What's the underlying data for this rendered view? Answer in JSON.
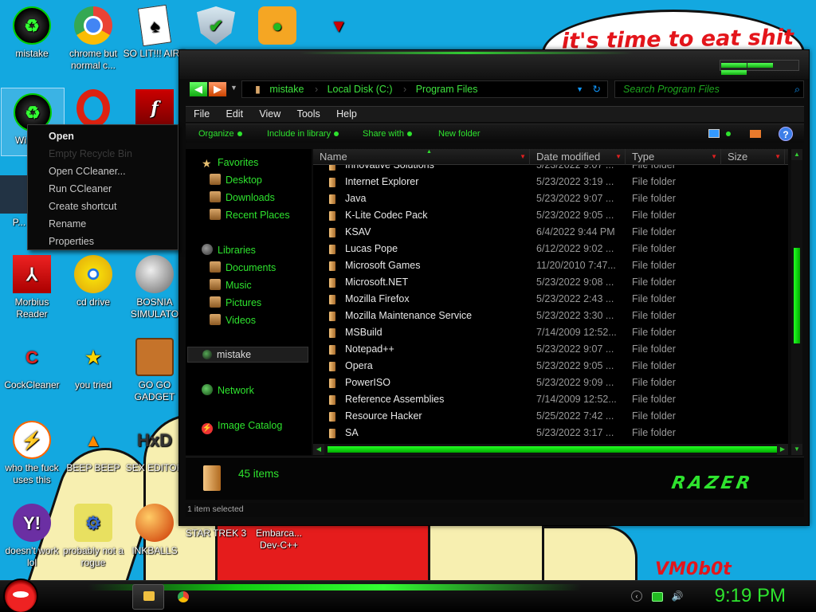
{
  "wallpaper": {
    "bubble_text": "it's time to eat shit",
    "signature": "VM0b0t"
  },
  "desktop_icons": [
    {
      "label": "mistake",
      "icon": "razer-recycle-icon"
    },
    {
      "label": "chrome but normal c...",
      "icon": "chrome-icon"
    },
    {
      "label": "SO LIT!!! AIRE",
      "icon": "playing-cards-icon"
    },
    {
      "label": "",
      "icon": "shield-icon"
    },
    {
      "label": "",
      "icon": "bad-piggies-icon"
    },
    {
      "label": "",
      "icon": "eagle-logo-icon"
    },
    {
      "label": "Wi... V...",
      "icon": "recycle-bin-icon"
    },
    {
      "label": "",
      "icon": "opera-icon"
    },
    {
      "label": "",
      "icon": "flash-icon"
    },
    {
      "label": "P...",
      "icon": "partial-icon"
    },
    {
      "label": "Morbius Reader",
      "icon": "pdf-reader-icon"
    },
    {
      "label": "cd drive",
      "icon": "cd-icon"
    },
    {
      "label": "BOSNIA SIMULATO",
      "icon": "mine-icon"
    },
    {
      "label": "CockCleaner",
      "icon": "ccleaner-icon"
    },
    {
      "label": "you tried",
      "icon": "star-icon"
    },
    {
      "label": "GO GO GADGET",
      "icon": "briefcase-icon"
    },
    {
      "label": "who the fuck uses this",
      "icon": "bolt-icon"
    },
    {
      "label": "BEEP BEEP",
      "icon": "vlc-icon"
    },
    {
      "label": "SEX EDITOR",
      "icon": "hxd-icon"
    },
    {
      "label": "doesn't work lol",
      "icon": "yahoo-icon"
    },
    {
      "label": "probably not a rogue",
      "icon": "gear-box-icon"
    },
    {
      "label": "INKBALLS",
      "icon": "inkball-icon"
    },
    {
      "label": "STAR TREK 3",
      "icon": "star-trek-icon"
    },
    {
      "label": "Embarca... Dev-C++",
      "icon": "devcpp-icon"
    }
  ],
  "context_menu": {
    "items": [
      {
        "label": "Open",
        "style": "bold"
      },
      {
        "label": "Empty Recycle Bin",
        "style": "disabled"
      },
      {
        "label": "Open CCleaner...",
        "style": "normal"
      },
      {
        "label": "Run CCleaner",
        "style": "normal"
      },
      {
        "label": "Create shortcut",
        "style": "normal"
      },
      {
        "label": "Rename",
        "style": "normal"
      },
      {
        "label": "Properties",
        "style": "normal"
      }
    ]
  },
  "explorer": {
    "address": {
      "crumbs": [
        "mistake",
        "Local Disk (C:)",
        "Program Files"
      ]
    },
    "search_placeholder": "Search Program Files",
    "menu": [
      "File",
      "Edit",
      "View",
      "Tools",
      "Help"
    ],
    "commands": [
      "Organize",
      "Include in library",
      "Share with",
      "New folder"
    ],
    "nav": {
      "favorites_label": "Favorites",
      "favorites": [
        "Desktop",
        "Downloads",
        "Recent Places"
      ],
      "libraries_label": "Libraries",
      "libraries": [
        "Documents",
        "Music",
        "Pictures",
        "Videos"
      ],
      "user": "mistake",
      "network": "Network",
      "catalog": "Image Catalog"
    },
    "columns": [
      "Name",
      "Date modified",
      "Type",
      "Size"
    ],
    "files": [
      {
        "name": "Innovative Solutions",
        "date": "5/23/2022 9:07 ...",
        "type": "File folder"
      },
      {
        "name": "Internet Explorer",
        "date": "5/23/2022 3:19 ...",
        "type": "File folder"
      },
      {
        "name": "Java",
        "date": "5/23/2022 9:07 ...",
        "type": "File folder"
      },
      {
        "name": "K-Lite Codec Pack",
        "date": "5/23/2022 9:05 ...",
        "type": "File folder"
      },
      {
        "name": "KSAV",
        "date": "6/4/2022 9:44 PM",
        "type": "File folder"
      },
      {
        "name": "Lucas Pope",
        "date": "6/12/2022 9:02 ...",
        "type": "File folder"
      },
      {
        "name": "Microsoft Games",
        "date": "11/20/2010 7:47...",
        "type": "File folder"
      },
      {
        "name": "Microsoft.NET",
        "date": "5/23/2022 9:08 ...",
        "type": "File folder"
      },
      {
        "name": "Mozilla Firefox",
        "date": "5/23/2022 2:43 ...",
        "type": "File folder"
      },
      {
        "name": "Mozilla Maintenance Service",
        "date": "5/23/2022 3:30 ...",
        "type": "File folder"
      },
      {
        "name": "MSBuild",
        "date": "7/14/2009 12:52...",
        "type": "File folder"
      },
      {
        "name": "Notepad++",
        "date": "5/23/2022 9:07 ...",
        "type": "File folder"
      },
      {
        "name": "Opera",
        "date": "5/23/2022 9:05 ...",
        "type": "File folder"
      },
      {
        "name": "PowerISO",
        "date": "5/23/2022 9:09 ...",
        "type": "File folder"
      },
      {
        "name": "Reference Assemblies",
        "date": "7/14/2009 12:52...",
        "type": "File folder"
      },
      {
        "name": "Resource Hacker",
        "date": "5/25/2022 7:42 ...",
        "type": "File folder"
      },
      {
        "name": "SA",
        "date": "5/23/2022 3:17 ...",
        "type": "File folder"
      }
    ],
    "details": {
      "count": "45 items",
      "brand": "RAZER"
    },
    "status": "1 item selected"
  },
  "taskbar": {
    "clock": "9:19 PM"
  },
  "colors": {
    "accent_green": "#2ee32e",
    "window_bg": "#0c0c0c",
    "desktop_blue": "#13a8e0"
  }
}
